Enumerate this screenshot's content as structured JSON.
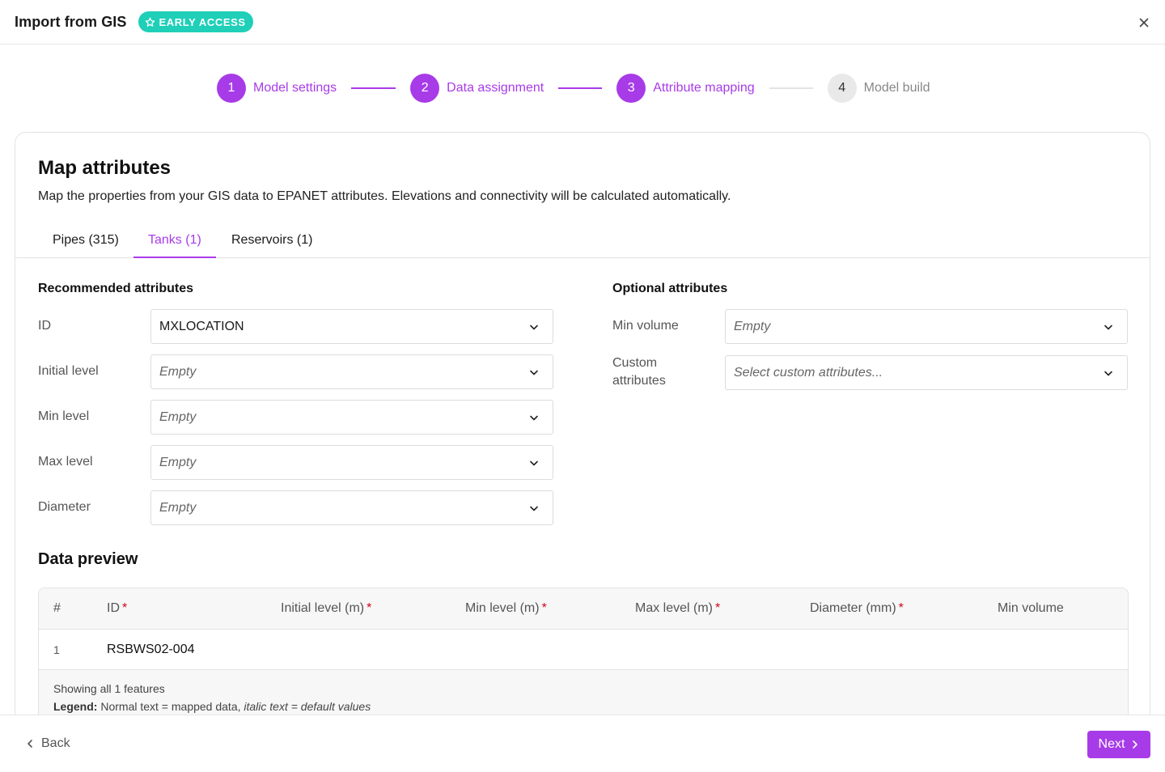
{
  "header": {
    "title": "Import from GIS",
    "badge": "EARLY ACCESS",
    "badge_icon": "star-icon",
    "close_icon": "close-icon"
  },
  "stepper": {
    "steps": [
      {
        "number": "1",
        "label": "Model settings",
        "state": "done"
      },
      {
        "number": "2",
        "label": "Data assignment",
        "state": "done"
      },
      {
        "number": "3",
        "label": "Attribute mapping",
        "state": "current"
      },
      {
        "number": "4",
        "label": "Model build",
        "state": "upcoming"
      }
    ]
  },
  "card": {
    "title": "Map attributes",
    "description": "Map the properties from your GIS data to EPANET attributes. Elevations and connectivity will be calculated automatically.",
    "tabs": [
      {
        "label": "Pipes (315)",
        "active": false
      },
      {
        "label": "Tanks (1)",
        "active": true
      },
      {
        "label": "Reservoirs (1)",
        "active": false
      }
    ],
    "recommended": {
      "title": "Recommended attributes",
      "rows": [
        {
          "label": "ID",
          "value": "MXLOCATION",
          "placeholder": false
        },
        {
          "label": "Initial level",
          "value": "Empty",
          "placeholder": true
        },
        {
          "label": "Min level",
          "value": "Empty",
          "placeholder": true
        },
        {
          "label": "Max level",
          "value": "Empty",
          "placeholder": true
        },
        {
          "label": "Diameter",
          "value": "Empty",
          "placeholder": true
        }
      ]
    },
    "optional": {
      "title": "Optional attributes",
      "rows": [
        {
          "label": "Min volume",
          "value": "Empty",
          "placeholder": true
        },
        {
          "label_line1": "Custom",
          "label_line2": "attributes",
          "value": "Select custom attributes...",
          "placeholder": true
        }
      ]
    },
    "preview": {
      "title": "Data preview",
      "columns": [
        {
          "label": "#",
          "required": false
        },
        {
          "label": "ID",
          "required": true
        },
        {
          "label": "Initial level (m)",
          "required": true
        },
        {
          "label": "Min level (m)",
          "required": true
        },
        {
          "label": "Max level (m)",
          "required": true
        },
        {
          "label": "Diameter (mm)",
          "required": true
        },
        {
          "label": "Min volume",
          "required": false
        }
      ],
      "required_mark": "*",
      "rows": [
        {
          "num": "1",
          "id": "RSBWS02-004"
        }
      ],
      "footer_count": "Showing all 1 features",
      "legend_label": "Legend:",
      "legend_normal": "Normal text = mapped data,",
      "legend_italic": "italic text = default values"
    }
  },
  "footer": {
    "back_label": "Back",
    "next_label": "Next"
  },
  "colors": {
    "accent": "#a83be8",
    "badge": "#1fcfb8",
    "required": "#d0021b"
  }
}
